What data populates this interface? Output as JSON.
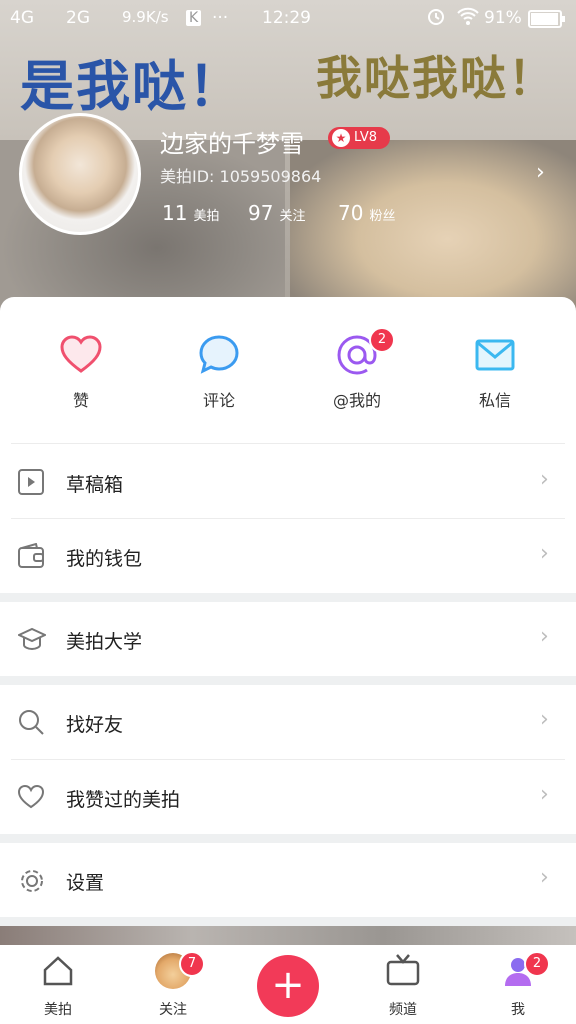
{
  "status_bar": {
    "network": "4G",
    "network2": "2G",
    "speed": "9.9K/s",
    "app_icon": "K",
    "more": "···",
    "time": "12:29",
    "battery": "91%"
  },
  "header_banner": {
    "text_left": "是我哒！",
    "text_right": "我哒我哒！"
  },
  "profile": {
    "username": "边家的千梦雪",
    "level": "LV8",
    "meipai_id": "美拍ID: 1059509864",
    "stats": [
      {
        "value": "11",
        "label": "美拍"
      },
      {
        "value": "97",
        "label": "关注"
      },
      {
        "value": "70",
        "label": "粉丝"
      }
    ]
  },
  "quick_actions": [
    {
      "label": "赞",
      "icon": "heart-icon",
      "color": "#f0506e",
      "badge": ""
    },
    {
      "label": "评论",
      "icon": "comment-icon",
      "color": "#3b9bf0",
      "badge": ""
    },
    {
      "label": "@我的",
      "icon": "at-icon",
      "color": "#9b59f0",
      "badge": "2"
    },
    {
      "label": "私信",
      "icon": "mail-icon",
      "color": "#3bb8f0",
      "badge": ""
    }
  ],
  "menu_rows": [
    {
      "label": "草稿箱",
      "icon": "draft-icon"
    },
    {
      "label": "我的钱包",
      "icon": "wallet-icon"
    },
    {
      "label": "美拍大学",
      "icon": "graduation-cap-icon"
    },
    {
      "label": "找好友",
      "icon": "search-icon"
    },
    {
      "label": "我赞过的美拍",
      "icon": "heart-outline-icon"
    },
    {
      "label": "设置",
      "icon": "gear-icon"
    }
  ],
  "tabbar": {
    "tabs": [
      {
        "label": "美拍",
        "icon": "home-icon",
        "badge": ""
      },
      {
        "label": "关注",
        "icon": "follow-avatar-icon",
        "badge": "7"
      },
      {
        "label": "频道",
        "icon": "tv-icon",
        "badge": ""
      },
      {
        "label": "我",
        "icon": "profile-icon",
        "badge": "2"
      }
    ],
    "add": "+"
  },
  "colors": {
    "accent": "#f23a58",
    "badge": "#f0364e"
  }
}
